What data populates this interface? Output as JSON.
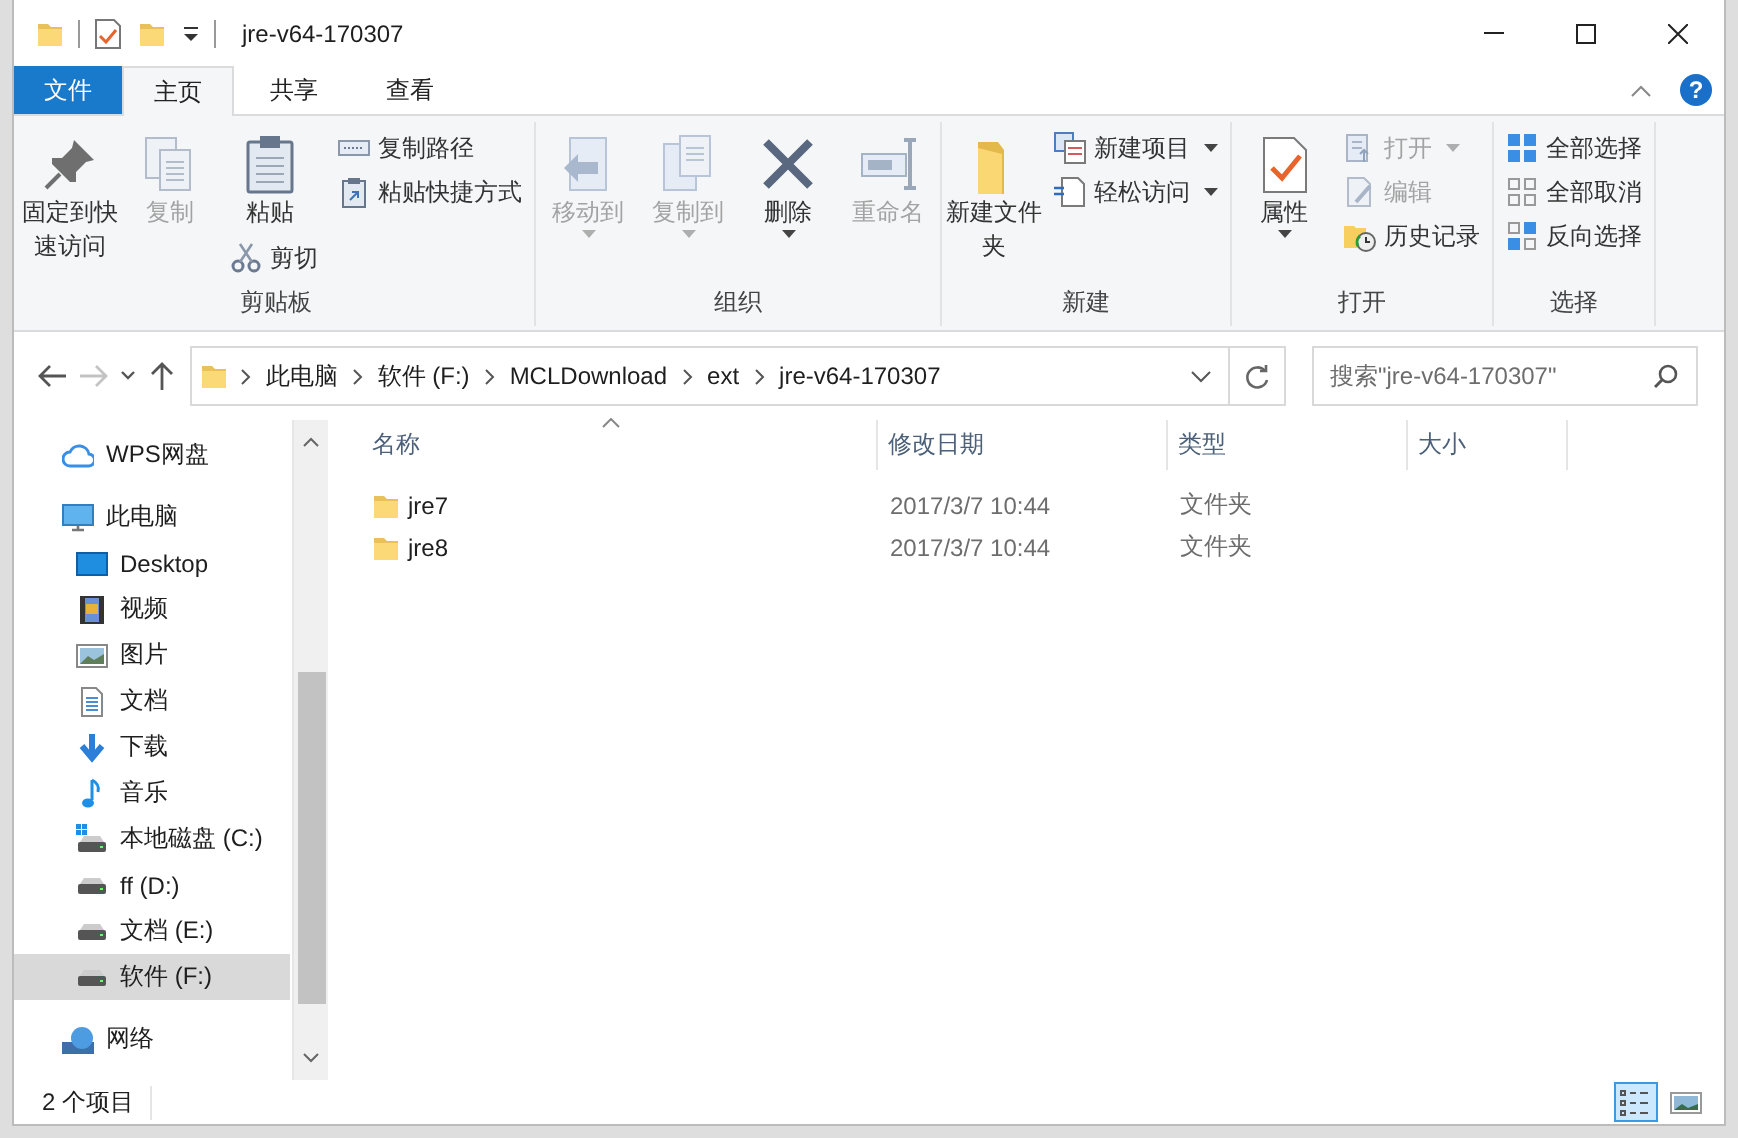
{
  "window": {
    "title": "jre-v64-170307"
  },
  "ribbon_tabs": [
    {
      "label": "文件",
      "kind": "file",
      "selected": false
    },
    {
      "label": "主页",
      "kind": "tab",
      "selected": true
    },
    {
      "label": "共享",
      "kind": "tab",
      "selected": false
    },
    {
      "label": "查看",
      "kind": "tab",
      "selected": false
    }
  ],
  "help_button": "?",
  "ribbon": {
    "groups": [
      {
        "label": "剪贴板",
        "columns": [
          [
            {
              "label": "固定到快速访问",
              "kind": "large",
              "disabled": false,
              "menu": false
            }
          ],
          [
            {
              "label": "复制",
              "kind": "large",
              "disabled": true,
              "menu": false
            }
          ],
          [
            {
              "label": "粘贴",
              "kind": "large",
              "disabled": false,
              "menu": false
            },
            {
              "label": "剪切",
              "kind": "small",
              "disabled": false,
              "menu": false
            }
          ],
          [
            {
              "label": "复制路径",
              "kind": "small",
              "disabled": false,
              "menu": false
            },
            {
              "label": "粘贴快捷方式",
              "kind": "small",
              "disabled": false,
              "menu": false
            }
          ]
        ]
      },
      {
        "label": "组织",
        "columns": [
          [
            {
              "label": "移动到",
              "kind": "large",
              "disabled": true,
              "menu": true
            }
          ],
          [
            {
              "label": "复制到",
              "kind": "large",
              "disabled": true,
              "menu": true
            }
          ],
          [
            {
              "label": "删除",
              "kind": "large",
              "disabled": false,
              "menu": true
            }
          ],
          [
            {
              "label": "重命名",
              "kind": "large",
              "disabled": true,
              "menu": false
            }
          ]
        ]
      },
      {
        "label": "新建",
        "columns": [
          [
            {
              "label": "新建文件夹",
              "kind": "large",
              "disabled": false,
              "menu": false
            }
          ],
          [
            {
              "label": "新建项目",
              "kind": "small",
              "disabled": false,
              "menu": true
            },
            {
              "label": "轻松访问",
              "kind": "small",
              "disabled": false,
              "menu": true
            }
          ]
        ]
      },
      {
        "label": "打开",
        "columns": [
          [
            {
              "label": "属性",
              "kind": "large",
              "disabled": false,
              "menu": true
            }
          ],
          [
            {
              "label": "打开",
              "kind": "small",
              "disabled": true,
              "menu": true
            },
            {
              "label": "编辑",
              "kind": "small",
              "disabled": true,
              "menu": false
            },
            {
              "label": "历史记录",
              "kind": "small",
              "disabled": false,
              "menu": false
            }
          ]
        ]
      },
      {
        "label": "选择",
        "columns": [
          [
            {
              "label": "全部选择",
              "kind": "small",
              "disabled": false,
              "menu": false
            },
            {
              "label": "全部取消",
              "kind": "small",
              "disabled": false,
              "menu": false
            },
            {
              "label": "反向选择",
              "kind": "small",
              "disabled": false,
              "menu": false
            }
          ]
        ]
      }
    ]
  },
  "address_bar": {
    "nav_buttons": [
      {
        "kind": "back",
        "disabled": false
      },
      {
        "kind": "forward",
        "disabled": true
      },
      {
        "kind": "recent",
        "disabled": false
      },
      {
        "kind": "up",
        "disabled": false
      }
    ],
    "breadcrumb": [
      "此电脑",
      "软件 (F:)",
      "MCLDownload",
      "ext",
      "jre-v64-170307"
    ],
    "search": {
      "placeholder": "搜索\"jre-v64-170307\""
    }
  },
  "nav_pane": {
    "items": [
      {
        "label": "WPS网盘",
        "kind": "cloud",
        "selected": false
      },
      {
        "label": "此电脑",
        "kind": "pc",
        "selected": false,
        "children": [
          {
            "label": "Desktop",
            "kind": "desktop",
            "selected": false
          },
          {
            "label": "视频",
            "kind": "video",
            "selected": false
          },
          {
            "label": "图片",
            "kind": "pictures",
            "selected": false
          },
          {
            "label": "文档",
            "kind": "documents",
            "selected": false
          },
          {
            "label": "下载",
            "kind": "downloads",
            "selected": false
          },
          {
            "label": "音乐",
            "kind": "music",
            "selected": false
          },
          {
            "label": "本地磁盘 (C:)",
            "kind": "system_drive",
            "selected": false
          },
          {
            "label": "ff (D:)",
            "kind": "drive",
            "selected": false
          },
          {
            "label": "文档 (E:)",
            "kind": "drive",
            "selected": false
          },
          {
            "label": "软件 (F:)",
            "kind": "drive",
            "selected": true
          }
        ]
      },
      {
        "label": "网络",
        "kind": "network",
        "selected": false
      }
    ]
  },
  "file_list": {
    "columns": [
      {
        "label": "名称",
        "sorted": true
      },
      {
        "label": "修改日期",
        "sorted": false
      },
      {
        "label": "类型",
        "sorted": false
      },
      {
        "label": "大小",
        "sorted": false
      }
    ],
    "rows": [
      {
        "name": "jre7",
        "modified": "2017/3/7 10:44",
        "type": "文件夹"
      },
      {
        "name": "jre8",
        "modified": "2017/3/7 10:44",
        "type": "文件夹"
      }
    ]
  },
  "status_bar": {
    "item_count": "2 个项目",
    "views": [
      {
        "kind": "details",
        "selected": true
      },
      {
        "kind": "large_icons",
        "selected": false
      }
    ]
  }
}
